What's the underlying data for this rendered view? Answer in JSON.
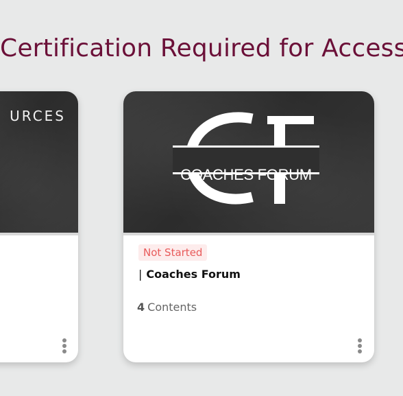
{
  "section": {
    "title": "Certification Required for Access)"
  },
  "cards": [
    {
      "banner_text": "URCES"
    },
    {
      "logo_text": "COACHES FORUM",
      "status": "Not Started",
      "status_color": "#e85a5a",
      "title_prefix": "|",
      "title": "Coaches Forum",
      "contents_count": "4",
      "contents_label": "Contents"
    }
  ],
  "colors": {
    "title": "#6b1038",
    "background": "#e8e9e9",
    "banner": "#2f2f2f"
  },
  "icons": {
    "menu": "kebab-menu-icon",
    "logo": "coaches-forum-logo"
  }
}
